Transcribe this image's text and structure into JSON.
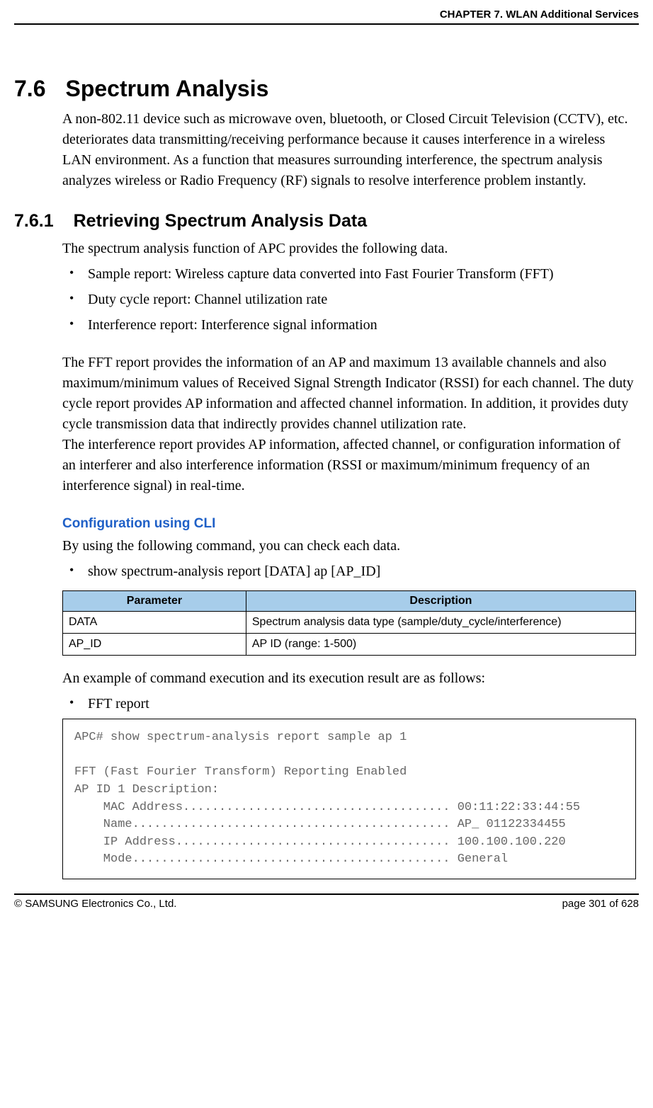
{
  "header": {
    "chapter": "CHAPTER 7. WLAN Additional Services"
  },
  "section": {
    "number": "7.6",
    "title": "Spectrum Analysis",
    "intro": "A non-802.11 device such as microwave oven, bluetooth, or Closed Circuit Television (CCTV), etc. deteriorates data transmitting/receiving performance because it causes interference in a wireless LAN environment. As a function that measures surrounding interference, the spectrum analysis analyzes wireless or Radio Frequency (RF) signals to resolve interference problem instantly."
  },
  "subsection": {
    "number": "7.6.1",
    "title": "Retrieving Spectrum Analysis Data",
    "intro": "The spectrum analysis function of APC provides the following data.",
    "bullets": [
      "Sample report: Wireless capture data converted into Fast Fourier Transform (FFT)",
      "Duty cycle report: Channel utilization rate",
      "Interference report: Interference signal information"
    ],
    "para2": "The FFT report provides the information of an AP and maximum 13 available channels and also maximum/minimum values of Received Signal Strength Indicator (RSSI) for each channel. The duty cycle report provides AP information and affected channel information. In addition, it provides duty cycle transmission data that indirectly provides channel utilization rate.",
    "para3": "The interference report provides AP information, affected channel, or configuration information of an interferer and also interference information (RSSI or maximum/minimum frequency of an interference signal) in real-time."
  },
  "cli": {
    "heading": "Configuration using CLI",
    "text": "By using the following command, you can check each data.",
    "bullets": [
      "show spectrum-analysis report [DATA] ap [AP_ID]"
    ]
  },
  "table": {
    "head": {
      "param": "Parameter",
      "desc": "Description"
    },
    "rows": [
      {
        "param": "DATA",
        "desc": "Spectrum analysis data type (sample/duty_cycle/interference)"
      },
      {
        "param": "AP_ID",
        "desc": "AP ID (range: 1-500)"
      }
    ]
  },
  "example": {
    "intro": "An example of command execution and its execution result are as follows:",
    "bullets": [
      "FFT report"
    ],
    "code": "APC# show spectrum-analysis report sample ap 1\n\nFFT (Fast Fourier Transform) Reporting Enabled\nAP ID 1 Description:\n    MAC Address..................................... 00:11:22:33:44:55\n    Name............................................ AP_ 01122334455\n    IP Address...................................... 100.100.100.220\n    Mode............................................ General"
  },
  "footer": {
    "copyright": "© SAMSUNG Electronics Co., Ltd.",
    "page": "page 301 of 628"
  }
}
